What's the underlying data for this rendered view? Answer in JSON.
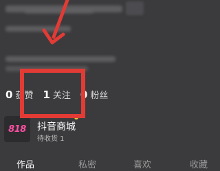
{
  "stats": [
    {
      "value": "0",
      "label": "获赞"
    },
    {
      "value": "1",
      "label": "关注"
    },
    {
      "value": "0",
      "label": "粉丝"
    }
  ],
  "mall": {
    "logo_text": "818",
    "title": "抖音商城",
    "subtitle": "待收货 1"
  },
  "tabs": [
    "作品",
    "私密",
    "喜欢",
    "收藏"
  ],
  "colors": {
    "background": "#3b3b3d",
    "highlight": "#e23b35",
    "mall_logo": "#ff4fa3",
    "dot": "#f0c23a"
  }
}
